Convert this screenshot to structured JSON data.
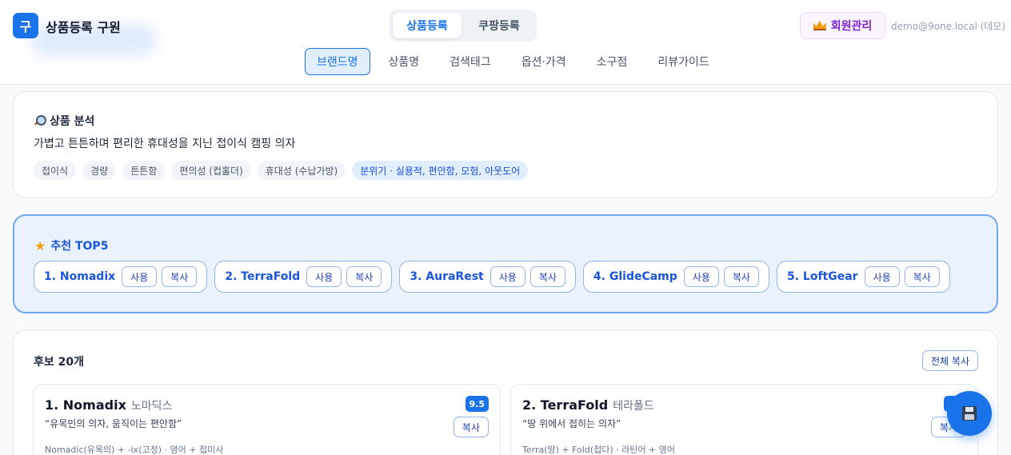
{
  "app": {
    "logo_char": "구",
    "title": "상품등록 구원"
  },
  "mode_tabs": [
    {
      "label": "상품등록",
      "active": true
    },
    {
      "label": "쿠팡등록",
      "active": false
    }
  ],
  "account": {
    "member_label": "회원관리",
    "email": "demo@9one.local (데모)"
  },
  "sub_tabs": [
    {
      "label": "브랜드명",
      "active": true
    },
    {
      "label": "상품명"
    },
    {
      "label": "검색태그"
    },
    {
      "label": "옵션·가격"
    },
    {
      "label": "소구점"
    },
    {
      "label": "리뷰가이드"
    }
  ],
  "analysis": {
    "title": "상품 분석",
    "summary": "가볍고 튼튼하며 편리한 휴대성을 지닌 접이식 캠핑 의자",
    "chips": [
      "접이식",
      "경량",
      "튼튼함",
      "편의성 (컵홀더)",
      "휴대성 (수납가방)"
    ],
    "mood": "분위기 · 실용적, 편안함, 모험, 아웃도어"
  },
  "top5": {
    "title": "추천 TOP5",
    "use_label": "사용",
    "copy_label": "복사",
    "items": [
      "1. Nomadix",
      "2. TerraFold",
      "3. AuraRest",
      "4. GlideCamp",
      "5. LoftGear"
    ]
  },
  "candidates": {
    "title": "후보 20개",
    "copy_all_label": "전체 복사",
    "copy_label": "복사",
    "items": [
      {
        "name": "1. Nomadix",
        "kr": "노마딕스",
        "slogan": "“유목민의 의자, 움직이는 편안함”",
        "etymology": "Nomadic(유목의) + -ix(고정) · 영어 + 접미사",
        "score": "9.5"
      },
      {
        "name": "2. TerraFold",
        "kr": "테라폴드",
        "slogan": "“땅 위에서 접히는 의자”",
        "etymology": "Terra(땅) + Fold(접다) · 라틴어 + 영어",
        "score": ""
      }
    ]
  },
  "colors": {
    "accent": "#1a73e8",
    "member": "#7e22ce"
  },
  "icons": {
    "save": "floppy-disk-icon",
    "analysis": "magnifier-icon",
    "top5": "star-icon",
    "member": "crown-icon"
  }
}
